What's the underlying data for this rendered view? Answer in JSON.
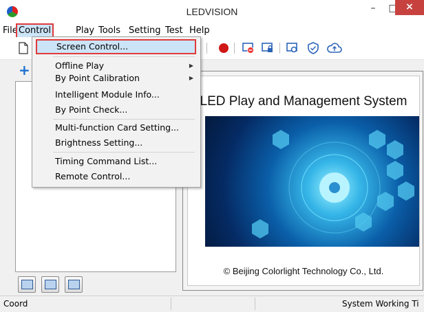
{
  "window": {
    "title": "LEDVISION",
    "minimize": "–",
    "maximize": "□",
    "close": "×"
  },
  "menubar": [
    "File",
    "Control",
    "Play",
    "Tools",
    "Setting",
    "Test",
    "Help"
  ],
  "control_menu": {
    "items": [
      {
        "label": "Screen Control...",
        "highlighted": true
      },
      {
        "label": "Offline Play",
        "submenu": true
      },
      {
        "label": "By Point Calibration",
        "submenu": true
      },
      {
        "label": "Intelligent Module Info..."
      },
      {
        "label": "By Point Check..."
      },
      {
        "label": "Multi-function Card Setting..."
      },
      {
        "label": "Brightness Setting..."
      },
      {
        "label": "Timing Command List..."
      },
      {
        "label": "Remote Control..."
      }
    ]
  },
  "splash": {
    "title": "LED Play and Management System",
    "footer": "© Beijing Colorlight Technology Co., Ltd."
  },
  "statusbar": {
    "left": "Coord",
    "right": "System Working Ti"
  },
  "colors": {
    "highlight_border": "#e03a3a",
    "selection": "#cce4f7",
    "close_button": "#c7423f"
  },
  "icons": [
    "app-logo-icon",
    "new-file-icon",
    "record-icon",
    "screen-lock-icon",
    "shield-icon",
    "cloud-icon",
    "add-icon"
  ]
}
